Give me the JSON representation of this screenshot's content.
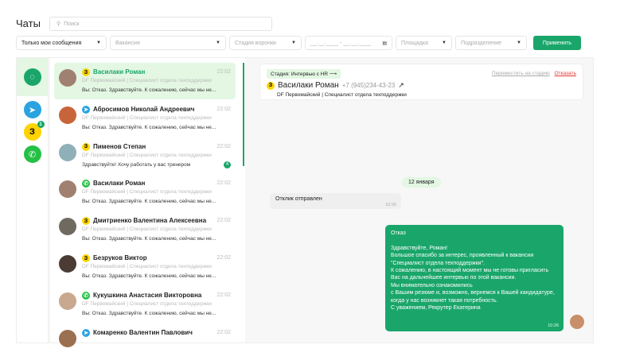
{
  "header": {
    "title": "Чаты",
    "search_placeholder": "Поиск"
  },
  "filters": {
    "mine": "Только мои сообщения",
    "vacancy": "Вакансия",
    "stage": "Стадия воронки",
    "date": "__.__.____ - __.__.____",
    "site": "Площадка",
    "division": "Подразделение",
    "apply": "Применить"
  },
  "rail": {
    "zarplata_unread": "1"
  },
  "chats": [
    {
      "name": "Василаки Роман",
      "source": "zarplata",
      "time": "22:02",
      "sub": "DF Первомайский  |  Специалист отдела техподдержки",
      "msg": "Вы: Отказ. Здравствуйте. К сожалению, сейчас мы не...",
      "unread": "",
      "color": "#a08070"
    },
    {
      "name": "Абросимов Николай Андреевич",
      "source": "telegram",
      "time": "22:02",
      "sub": "DF Первомайский  |  Специалист отдела техподдержки",
      "msg": "Вы: Отказ. Здравствуйте. К сожалению, сейчас мы не...",
      "unread": "",
      "color": "#c8643a"
    },
    {
      "name": "Пименов Степан",
      "source": "zarplata",
      "time": "22:02",
      "sub": "DF Первомайский  |  Специалист отдела техподдержки",
      "msg": "Здравствуйте! Хочу работать у вас тренером",
      "unread": "4",
      "color": "#8fb0b8"
    },
    {
      "name": "Василаки Роман",
      "source": "whatsapp",
      "time": "22:02",
      "sub": "DF Первомайский  |  Специалист отдела техподдержки",
      "msg": "Вы: Отказ. Здравствуйте. К сожалению, сейчас мы не...",
      "unread": "",
      "color": "#a08070"
    },
    {
      "name": "Дмитриенко Валентина Алексеевна",
      "source": "zarplata",
      "time": "22:02",
      "sub": "DF Первомайский  |  Специалист отдела техподдержки",
      "msg": "Вы: Отказ. Здравствуйте. К сожалению, сейчас мы не...",
      "unread": "",
      "color": "#6f6a60"
    },
    {
      "name": "Безруков Виктор",
      "source": "zarplata",
      "time": "22:02",
      "sub": "DF Первомайский  |  Специалист отдела техподдержки",
      "msg": "Вы: Отказ. Здравствуйте. К сожалению, сейчас мы не...",
      "unread": "",
      "color": "#4a3c34"
    },
    {
      "name": "Кукушкина Анастасия Викторовна",
      "source": "whatsapp",
      "time": "22:02",
      "sub": "DF Первомайский  |  Специалист отдела техподдержки",
      "msg": "Вы: Отказ. Здравствуйте. К сожалению, сейчас мы не...",
      "unread": "",
      "color": "#c9a890"
    },
    {
      "name": "Комаренко Валентин Павлович",
      "source": "telegram",
      "time": "22:02",
      "sub": "",
      "msg": "",
      "unread": "",
      "color": "#9a7050"
    }
  ],
  "chat": {
    "stage": "Стадия: Интервью с HR  ⟶",
    "name": "Василаки Роман",
    "phone": "+7 (945)234-43-23",
    "sub": "DF Первомайский  |  Специалист отдела техподдержки",
    "move": "Переместить на стадию",
    "reject": "Отказать",
    "date": "12 января",
    "incoming": {
      "text": "Отклик отправлен",
      "time": "10:26"
    },
    "outgoing": {
      "text": "Отказ\n\nЗдравствуйте, Роман!\nБольшое спасибо за интерес, проявленный к вакансии \"Специалист отдела техподдержки\".\nК сожалению, в настоящий момент мы не готовы пригласить Вас на дальнейшее интервью по этой вакансии.\nМы внимательно ознакомились\nс Вашим резюме и, возможно, вернемся к Вашей кандидатуре, когда у нас возникнет такая потребность.\nС уважением, Рекрутер Екатерина",
      "time": "10:26"
    }
  },
  "colors": {
    "accent": "#1aa66a",
    "reject": "#e53935"
  }
}
